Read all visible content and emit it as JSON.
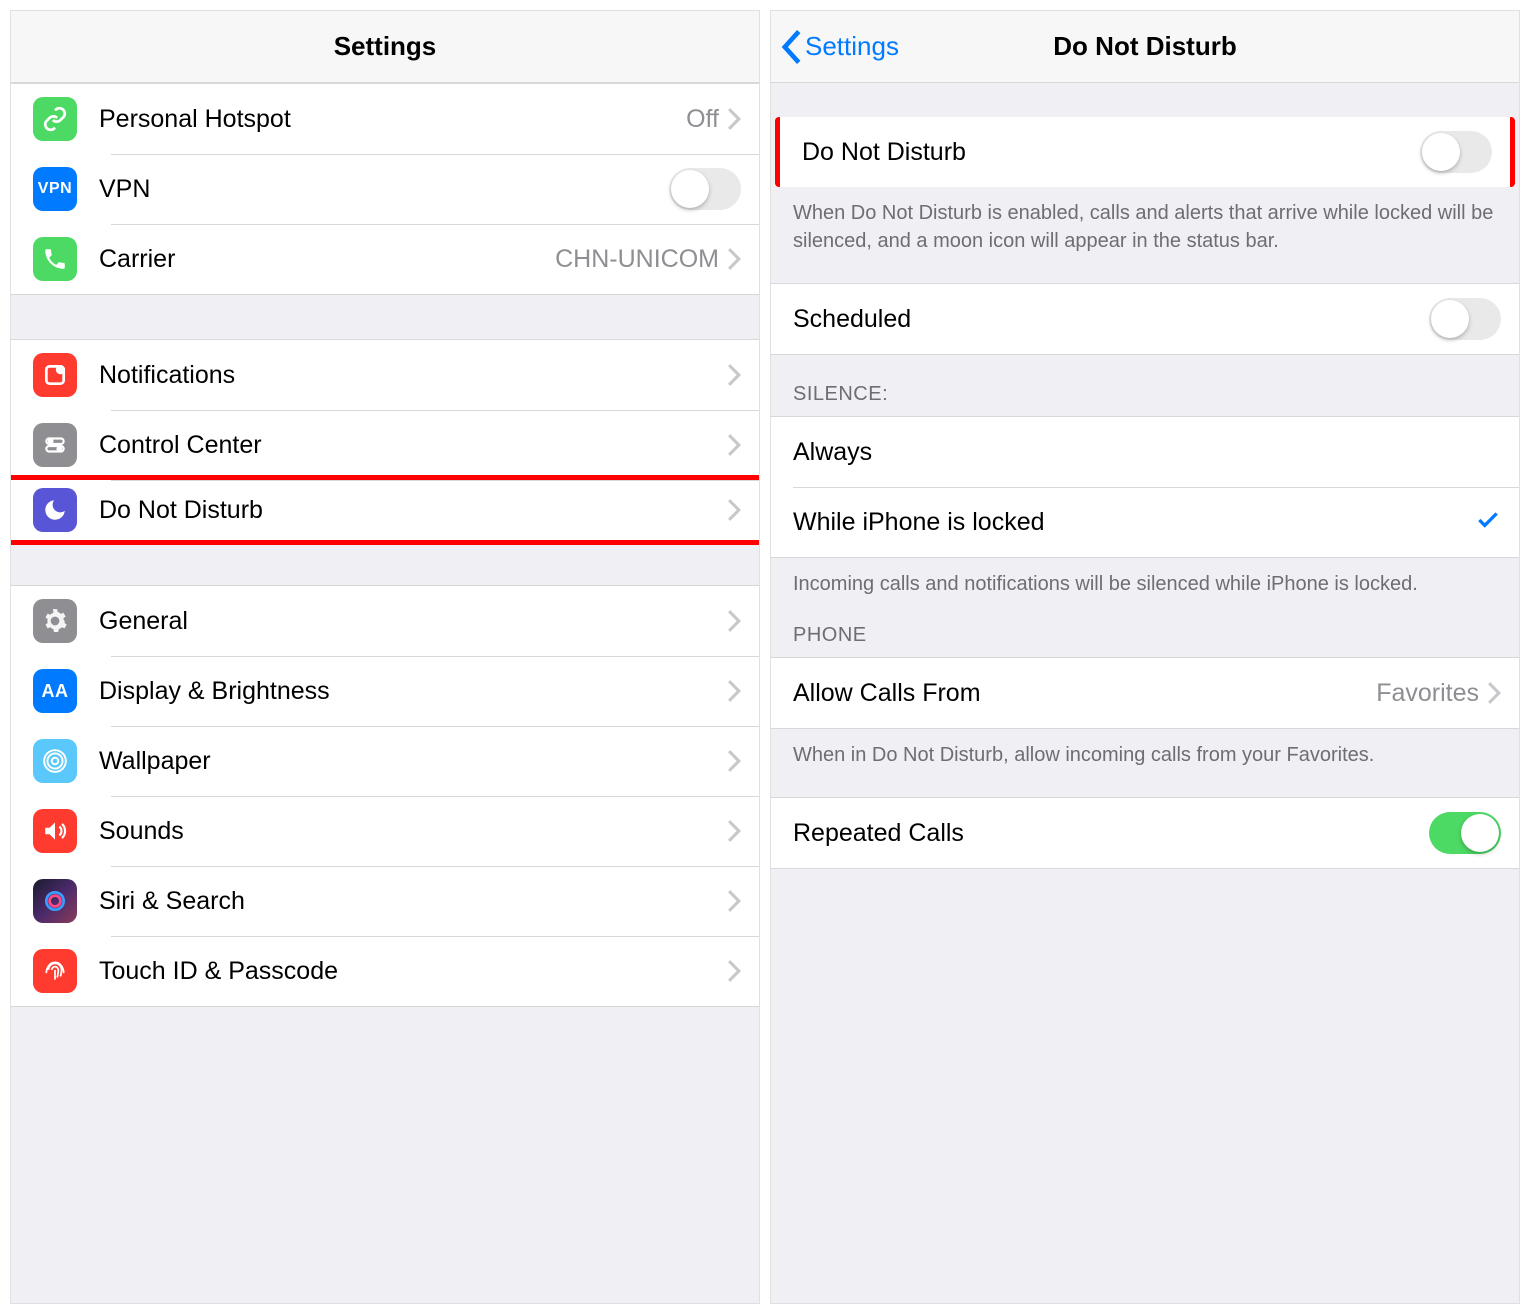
{
  "left": {
    "title": "Settings",
    "group1": [
      {
        "label": "Personal Hotspot",
        "value": "Off",
        "icon": "link",
        "bg": "bg-green"
      },
      {
        "label": "VPN",
        "value": "",
        "icon": "vpn-text",
        "bg": "bg-blue",
        "toggle": false
      },
      {
        "label": "Carrier",
        "value": "CHN-UNICOM",
        "icon": "phone",
        "bg": "bg-green"
      }
    ],
    "group2": [
      {
        "label": "Notifications",
        "icon": "notifications",
        "bg": "bg-red"
      },
      {
        "label": "Control Center",
        "icon": "controlcenter",
        "bg": "bg-gray"
      },
      {
        "label": "Do Not Disturb",
        "icon": "moon",
        "bg": "bg-purple",
        "highlight": true
      }
    ],
    "group3": [
      {
        "label": "General",
        "icon": "gear",
        "bg": "bg-gray"
      },
      {
        "label": "Display & Brightness",
        "icon": "display-text",
        "bg": "bg-blue"
      },
      {
        "label": "Wallpaper",
        "icon": "wallpaper",
        "bg": "bg-lightblue"
      },
      {
        "label": "Sounds",
        "icon": "sounds",
        "bg": "bg-red"
      },
      {
        "label": "Siri & Search",
        "icon": "siri",
        "bg": "bg-dark"
      },
      {
        "label": "Touch ID & Passcode",
        "icon": "fingerprint",
        "bg": "bg-red"
      }
    ]
  },
  "right": {
    "back": "Settings",
    "title": "Do Not Disturb",
    "dnd_label": "Do Not Disturb",
    "dnd_footer": "When Do Not Disturb is enabled, calls and alerts that arrive while locked will be silenced, and a moon icon will appear in the status bar.",
    "scheduled_label": "Scheduled",
    "silence_header": "SILENCE:",
    "silence_options": {
      "always": "Always",
      "locked": "While iPhone is locked"
    },
    "silence_footer": "Incoming calls and notifications will be silenced while iPhone is locked.",
    "phone_header": "PHONE",
    "allow_calls_label": "Allow Calls From",
    "allow_calls_value": "Favorites",
    "allow_calls_footer": "When in Do Not Disturb, allow incoming calls from your Favorites.",
    "repeated_calls_label": "Repeated Calls"
  }
}
